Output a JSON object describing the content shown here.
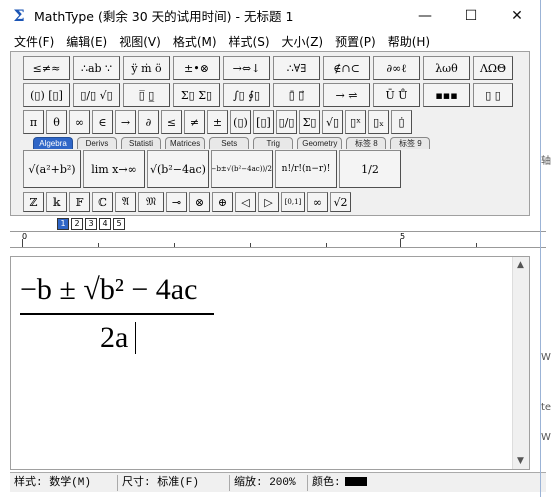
{
  "window": {
    "title": "MathType (剩余 30 天的试用时间) - 无标题 1",
    "app_icon": "Σ",
    "controls": {
      "minimize": "—",
      "maximize": "☐",
      "close": "✕"
    }
  },
  "menu": [
    "文件(F)",
    "编辑(E)",
    "视图(V)",
    "格式(M)",
    "样式(S)",
    "大小(Z)",
    "预置(P)",
    "帮助(H)"
  ],
  "toolbar": {
    "row1": [
      "≤≠≈",
      "∴ab ∵",
      "ÿ ṁ ö",
      "±•⊗",
      "→⇔↓",
      "∴∀∃",
      "∉∩⊂",
      "∂∞ℓ",
      "λωθ",
      "ΛΩΘ"
    ],
    "row2": [
      "(▯) [▯]",
      "▯/▯ √▯",
      "▯̅ ▯̲",
      "Σ▯ Σ▯",
      "∫▯ ∮▯",
      "▯̄ ▯⃗",
      "→ ⇌",
      "Ū Ů",
      "▪▪▪",
      "▯ ▯"
    ],
    "row3": [
      "π",
      "θ",
      "∞",
      "∈",
      "→",
      "∂",
      "≤",
      "≠",
      "±",
      "(▯)",
      "[▯]",
      "▯/▯",
      "Σ▯",
      "√▯",
      "▯ˣ",
      "▯ₓ",
      "▯̇"
    ],
    "tabs": [
      "Algebra",
      "Derivs",
      "Statisti",
      "Matrices",
      "Sets",
      "Trig",
      "Geometry",
      "标签 8",
      "标签 9"
    ],
    "active_tab": "Algebra",
    "row4": [
      "√(a²+b²)",
      "lim x→∞",
      "√(b²−4ac)",
      "(−b±√(b²−4ac))/2a",
      "n!/r!(n−r)!",
      "1/2"
    ],
    "row5": [
      "ℤ",
      "𝕜",
      "𝔽",
      "ℂ",
      "𝔄",
      "𝔐",
      "⊸",
      "⊗",
      "⊕",
      "◁",
      "▷",
      "[0,1]",
      "∞",
      "√2"
    ]
  },
  "size_buttons": [
    "1",
    "2",
    "3",
    "4",
    "5"
  ],
  "ruler": {
    "mark_0": "0",
    "mark_5": "5"
  },
  "equation": {
    "numerator": "−b ± √b² − 4ac",
    "denominator": "2a"
  },
  "status": {
    "style": "样式: 数学(M)",
    "size": "尺寸: 标准(F)",
    "zoom": "缩放: 200%",
    "color_label": "颜色:",
    "color_value": "#000000"
  },
  "background_peek": [
    "轴",
    "W",
    "te",
    "W"
  ]
}
